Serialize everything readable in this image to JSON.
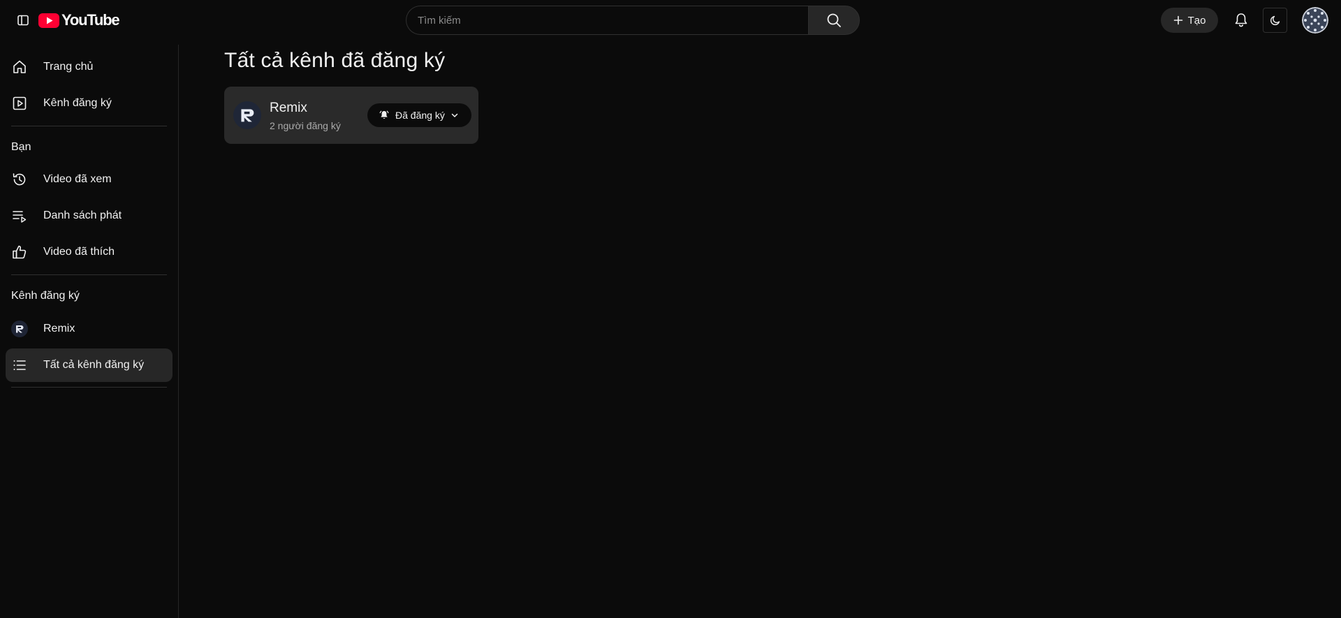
{
  "header": {
    "logo_text": "YouTube",
    "search_placeholder": "Tìm kiếm",
    "create_label": "Tạo"
  },
  "sidebar": {
    "main_items": [
      {
        "label": "Trang chủ",
        "icon": "home-icon"
      },
      {
        "label": "Kênh đăng ký",
        "icon": "subscriptions-icon"
      }
    ],
    "you_section": {
      "title": "Bạn",
      "items": [
        {
          "label": "Video đã xem",
          "icon": "history-icon"
        },
        {
          "label": "Danh sách phát",
          "icon": "playlist-icon"
        },
        {
          "label": "Video đã thích",
          "icon": "like-icon"
        }
      ]
    },
    "subs_section": {
      "title": "Kênh đăng ký",
      "items": [
        {
          "label": "Remix",
          "icon": "channel-avatar"
        },
        {
          "label": "Tất cả kênh đăng ký",
          "icon": "list-icon",
          "active": true
        }
      ]
    }
  },
  "main": {
    "title": "Tất cả kênh đã đăng ký",
    "channels": [
      {
        "name": "Remix",
        "subscribers": "2 người đăng ký",
        "subscribe_label": "Đã đăng ký"
      }
    ]
  },
  "colors": {
    "background": "#0b0b0b",
    "surface": "#272727",
    "card": "#2a2a2a",
    "brand_red": "#ff0033"
  }
}
